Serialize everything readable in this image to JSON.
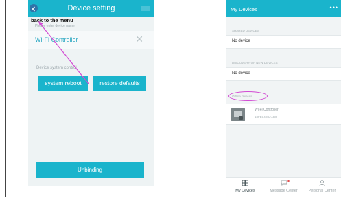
{
  "left_screen": {
    "header": {
      "title": "Device setting"
    },
    "annotation": "back to the menu",
    "name_hint": "Please enter device name",
    "device_name": "Wi-Fi Controller",
    "section_label": "Device system control",
    "buttons": {
      "reboot": "system reboot",
      "restore": "restore defaults",
      "unbind": "Unbinding"
    }
  },
  "right_screen": {
    "header": {
      "title": "My Devices",
      "more": "•••"
    },
    "sections": [
      {
        "label": "SHARED DEVICES",
        "row_text": "No device"
      },
      {
        "label": "DISCOVERY OF NEW DEVICES",
        "row_text": "No device"
      }
    ],
    "offline_label": "Offline devices",
    "offline_device": {
      "name": "Wi-Fi Controller",
      "mac": "18FE34D6A1B0"
    },
    "tabs": [
      {
        "label": "My Devices",
        "icon": "grid-icon",
        "active": true
      },
      {
        "label": "Message Center",
        "icon": "message-icon",
        "active": false,
        "badge": true
      },
      {
        "label": "Personal Center",
        "icon": "person-icon",
        "active": false
      }
    ]
  },
  "colors": {
    "accent": "#1ab4cc",
    "annotation": "#d24bd3",
    "background": "#eef3f4"
  }
}
